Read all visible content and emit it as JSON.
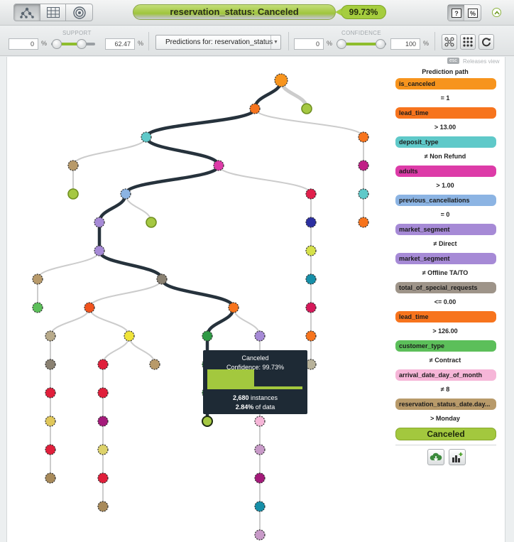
{
  "header": {
    "prediction_text": "reservation_status: Canceled",
    "confidence_badge": "99.73%",
    "view_icons": [
      "tree-view-icon",
      "table-view-icon",
      "sunburst-view-icon"
    ],
    "mode_icons": [
      "prediction-mode-icon",
      "confidence-mode-icon"
    ]
  },
  "filters": {
    "support_label": "SUPPORT",
    "support_min": "0",
    "support_max": "62.47",
    "support_range": [
      0,
      62.47
    ],
    "confidence_label": "CONFIDENCE",
    "confidence_min": "0",
    "confidence_max": "100",
    "confidence_range": [
      0,
      100
    ],
    "percent_sign": "%",
    "predictions_select": "Predictions for: reservation_status"
  },
  "canvas": {
    "esc_label": "esc",
    "releases_label": "Releases view"
  },
  "prediction_path": {
    "title": "Prediction path",
    "steps": [
      {
        "field": "is_canceled",
        "condition": "= 1",
        "color": "#f7941d"
      },
      {
        "field": "lead_time",
        "condition": "> 13.00",
        "color": "#f7741d"
      },
      {
        "field": "deposit_type",
        "condition": "≠ Non Refund",
        "color": "#5fc9c9"
      },
      {
        "field": "adults",
        "condition": "> 1.00",
        "color": "#dd3ba8"
      },
      {
        "field": "previous_cancellations",
        "condition": "= 0",
        "color": "#8cb4e3"
      },
      {
        "field": "market_segment",
        "condition": "≠ Direct",
        "color": "#a68ad6"
      },
      {
        "field": "market_segment",
        "condition": "≠ Offline TA/TO",
        "color": "#a68ad6"
      },
      {
        "field": "total_of_special_requests",
        "condition": "<= 0.00",
        "color": "#9e9489"
      },
      {
        "field": "lead_time",
        "condition": "> 126.00",
        "color": "#f7741d"
      },
      {
        "field": "customer_type",
        "condition": "≠ Contract",
        "color": "#5cbf5a"
      },
      {
        "field": "arrival_date_day_of_month",
        "condition": "≠ 8",
        "color": "#f6b6d8"
      },
      {
        "field": "reservation_status_date.day...",
        "condition": "> Monday",
        "color": "#b89a6a"
      }
    ],
    "prediction": "Canceled"
  },
  "tooltip": {
    "label": "Canceled",
    "confidence": "Confidence: 99.73%",
    "instances_count": "2,680",
    "instances_word": " instances",
    "data_pct": "2.84%",
    "data_word": " of data",
    "share_fraction": 0.49
  },
  "colors": {
    "path": "#26323c",
    "edge": "#cccccc",
    "leaf": "#a5c842",
    "accent": "#8ebd2d"
  }
}
